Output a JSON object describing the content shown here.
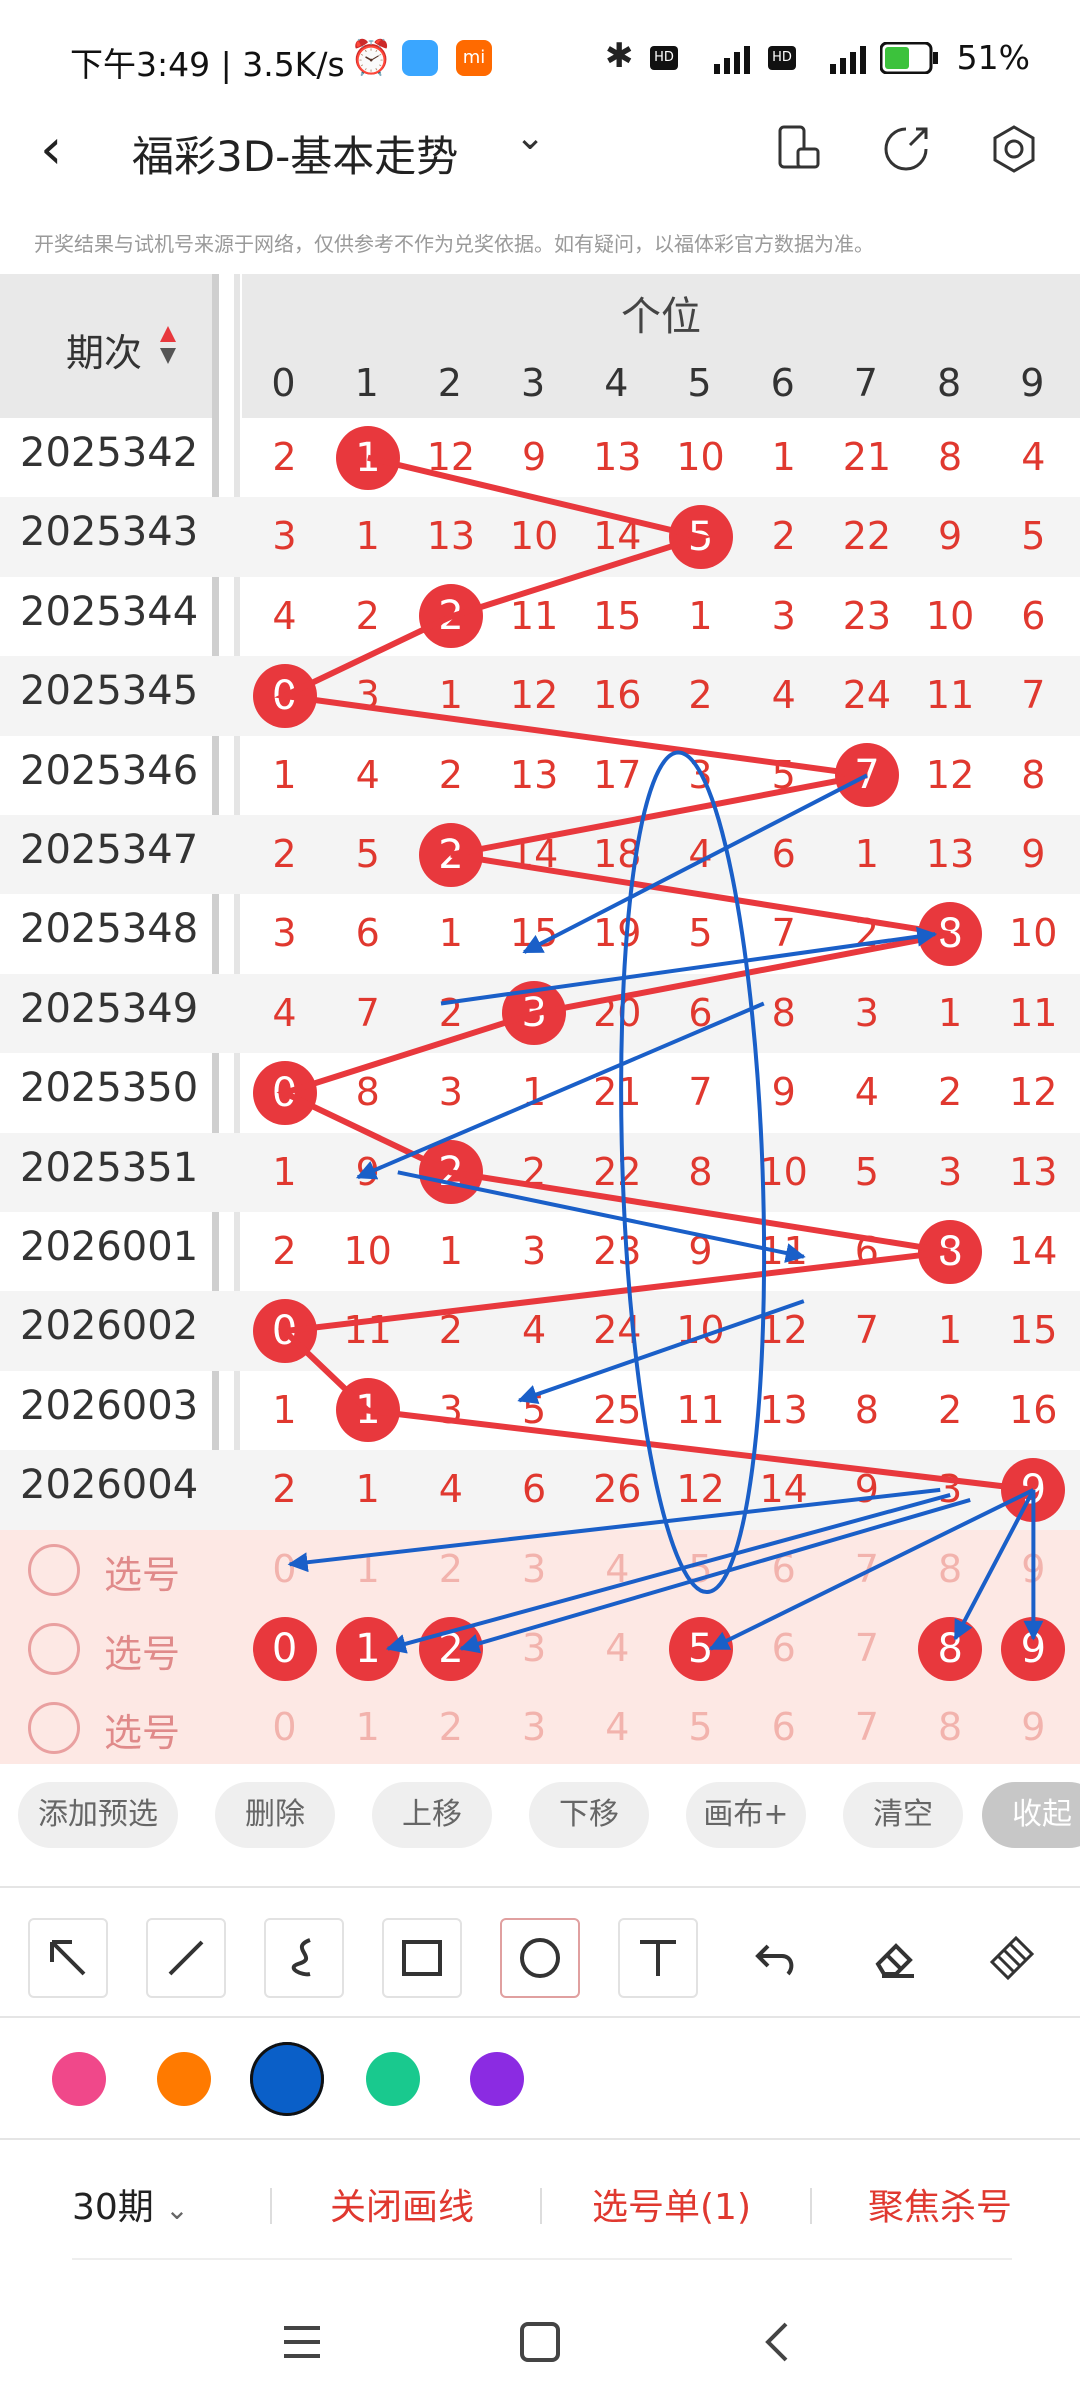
{
  "status": {
    "left": "下午3:49 | 3.5K/s",
    "right": "51%"
  },
  "app": {
    "title": "福彩3D-基本走势",
    "notice": "开奖结果与试机号来源于网络，仅供参考不作为兑奖依据。如有疑问，以福体彩官方数据为准。"
  },
  "table": {
    "period_header": "期次",
    "position_header": "个位",
    "digits": [
      "0",
      "1",
      "2",
      "3",
      "4",
      "5",
      "6",
      "7",
      "8",
      "9"
    ],
    "rows": [
      {
        "period": "2025342",
        "win": 1,
        "cells": [
          "2",
          "1",
          "12",
          "9",
          "13",
          "10",
          "1",
          "21",
          "8",
          "4"
        ]
      },
      {
        "period": "2025343",
        "win": 5,
        "cells": [
          "3",
          "1",
          "13",
          "10",
          "14",
          "5",
          "2",
          "22",
          "9",
          "5"
        ]
      },
      {
        "period": "2025344",
        "win": 2,
        "cells": [
          "4",
          "2",
          "2",
          "11",
          "15",
          "1",
          "3",
          "23",
          "10",
          "6"
        ]
      },
      {
        "period": "2025345",
        "win": 0,
        "cells": [
          "0",
          "3",
          "1",
          "12",
          "16",
          "2",
          "4",
          "24",
          "11",
          "7"
        ]
      },
      {
        "period": "2025346",
        "win": 7,
        "cells": [
          "1",
          "4",
          "2",
          "13",
          "17",
          "3",
          "5",
          "7",
          "12",
          "8"
        ]
      },
      {
        "period": "2025347",
        "win": 2,
        "cells": [
          "2",
          "5",
          "2",
          "14",
          "18",
          "4",
          "6",
          "1",
          "13",
          "9"
        ]
      },
      {
        "period": "2025348",
        "win": 8,
        "cells": [
          "3",
          "6",
          "1",
          "15",
          "19",
          "5",
          "7",
          "2",
          "8",
          "10"
        ]
      },
      {
        "period": "2025349",
        "win": 3,
        "cells": [
          "4",
          "7",
          "2",
          "3",
          "20",
          "6",
          "8",
          "3",
          "1",
          "11"
        ]
      },
      {
        "period": "2025350",
        "win": 0,
        "cells": [
          "0",
          "8",
          "3",
          "1",
          "21",
          "7",
          "9",
          "4",
          "2",
          "12"
        ]
      },
      {
        "period": "2025351",
        "win": 2,
        "cells": [
          "1",
          "9",
          "2",
          "2",
          "22",
          "8",
          "10",
          "5",
          "3",
          "13"
        ]
      },
      {
        "period": "2026001",
        "win": 8,
        "cells": [
          "2",
          "10",
          "1",
          "3",
          "23",
          "9",
          "11",
          "6",
          "8",
          "14"
        ]
      },
      {
        "period": "2026002",
        "win": 0,
        "cells": [
          "0",
          "11",
          "2",
          "4",
          "24",
          "10",
          "12",
          "7",
          "1",
          "15"
        ]
      },
      {
        "period": "2026003",
        "win": 1,
        "cells": [
          "1",
          "1",
          "3",
          "5",
          "25",
          "11",
          "13",
          "8",
          "2",
          "16"
        ]
      },
      {
        "period": "2026004",
        "win": 9,
        "cells": [
          "2",
          "1",
          "4",
          "6",
          "26",
          "12",
          "14",
          "9",
          "3",
          "9"
        ]
      }
    ],
    "select_label": "选号",
    "select_rows": [
      {
        "balls": []
      },
      {
        "balls": [
          0,
          1,
          2,
          5,
          8,
          9
        ]
      },
      {
        "balls": []
      }
    ]
  },
  "actions": [
    "添加预选",
    "删除",
    "上移",
    "下移",
    "画布+",
    "清空",
    "收起"
  ],
  "tools": [
    "arrow-tool-icon",
    "line-tool-icon",
    "curve-tool-icon",
    "rectangle-tool-icon",
    "ellipse-tool-icon",
    "text-tool-icon",
    "undo-icon",
    "eraser-icon",
    "clear-canvas-icon"
  ],
  "colors": [
    "#f0488a",
    "#ff7a00",
    "#0a5fc8",
    "#19c98e",
    "#8b2be2"
  ],
  "selected_color": "#0a5fc8",
  "bottom": {
    "periods": "30期",
    "close_lines": "关闭画线",
    "pick_list": "选号单(1)",
    "focus_kill": "聚焦杀号"
  }
}
